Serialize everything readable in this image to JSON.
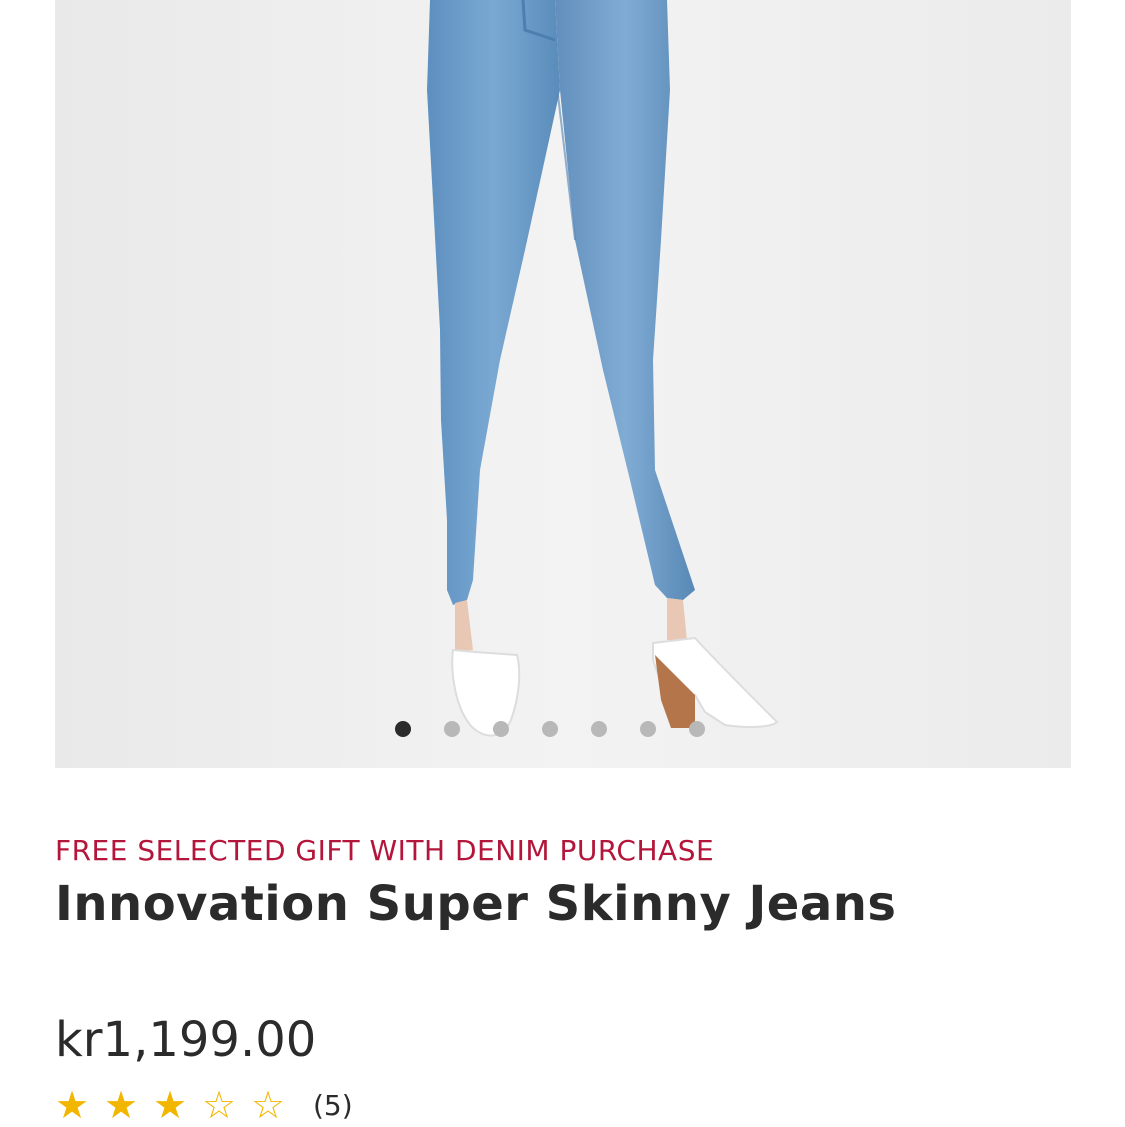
{
  "product": {
    "promo": "FREE SELECTED GIFT WITH DENIM PURCHASE",
    "title": "Innovation Super Skinny Jeans",
    "price": "kr1,199.00",
    "rating": {
      "value": 3,
      "max": 5,
      "stars": [
        "★",
        "★",
        "★",
        "☆",
        "☆"
      ],
      "count": "(5)"
    }
  },
  "carousel": {
    "total": 7,
    "active_index": 0
  },
  "colors": {
    "promo": "#b3163a",
    "star": "#f2b600",
    "text": "#2b2b2b",
    "denim": "#6b9ecb",
    "image_bg": "#eeeeee"
  }
}
